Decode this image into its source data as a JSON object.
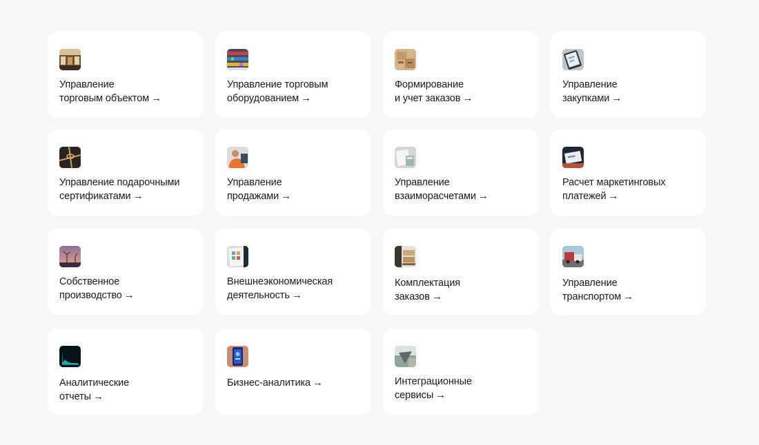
{
  "cards": [
    {
      "line1": "Управление",
      "line2": "торговым объектом",
      "icon": "store-interior-icon"
    },
    {
      "line1": "Управление торговым",
      "line2": "оборудованием",
      "icon": "retail-shelves-icon"
    },
    {
      "line1": "Формирование",
      "line2": "и учет заказов",
      "icon": "cardboard-boxes-icon"
    },
    {
      "line1": "Управление",
      "line2": "закупками",
      "icon": "tablet-purchasing-icon"
    },
    {
      "line1": "Управление подарочными",
      "line2": "сертификатами",
      "icon": "gift-ribbon-icon"
    },
    {
      "line1": "Управление",
      "line2": "продажами",
      "icon": "salesperson-icon"
    },
    {
      "line1": "Управление",
      "line2": "взаиморасчетами",
      "icon": "documents-calculator-icon"
    },
    {
      "line1": "Расчет маркетинговых",
      "line2": "платежей",
      "icon": "laptop-payments-icon"
    },
    {
      "line1": "Собственное",
      "line2": "производство",
      "icon": "wind-turbines-icon"
    },
    {
      "line1": "Внешнеэкономическая",
      "line2": "деятельность",
      "icon": "tablet-trade-icon"
    },
    {
      "line1": "Комплектация",
      "line2": "заказов",
      "icon": "warehouse-pallets-icon"
    },
    {
      "line1": "Управление",
      "line2": "транспортом",
      "icon": "truck-icon"
    },
    {
      "line1": "Аналитические",
      "line2": "отчеты",
      "icon": "analytics-chart-icon"
    },
    {
      "line1": "Бизнес-аналитика",
      "line2": "",
      "icon": "phone-dashboard-icon"
    },
    {
      "line1": "Интеграционные",
      "line2": "сервисы",
      "icon": "integration-screen-icon"
    }
  ],
  "arrow_glyph": "→"
}
